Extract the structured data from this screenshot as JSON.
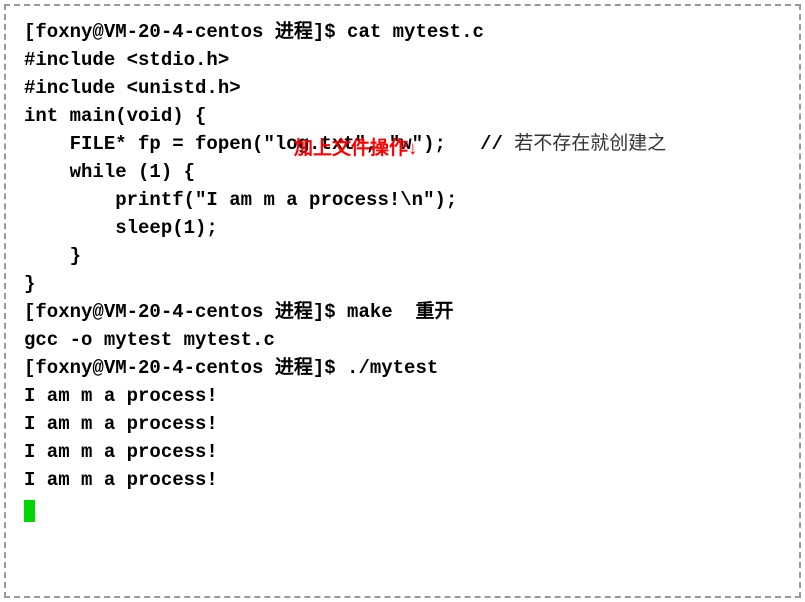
{
  "terminal": {
    "l1": "[foxny@VM-20-4-centos 进程]$ cat mytest.c",
    "l2": "#include <stdio.h>",
    "l3": "#include <unistd.h>",
    "l4": "",
    "l5": "int main(void) {",
    "l6a": "    FILE* fp = fopen(\"log.txt\", \"w\");   // ",
    "l6b": "若不存在就创建之",
    "l7": "    while (1) {",
    "l8": "        printf(\"I am m a process!\\n\");",
    "l9": "        sleep(1);",
    "l10": "    }",
    "l11": "}",
    "l12a": "[foxny@VM-20-4-centos 进程]$ make  ",
    "l12b": "重开",
    "l13": "gcc -o mytest mytest.c",
    "l14": "[foxny@VM-20-4-centos 进程]$ ./mytest",
    "l15": "I am m a process!",
    "l16": "I am m a process!",
    "l17": "I am m a process!",
    "l18": "I am m a process!"
  },
  "annotations": {
    "file_op": "加上文件操作↓"
  }
}
